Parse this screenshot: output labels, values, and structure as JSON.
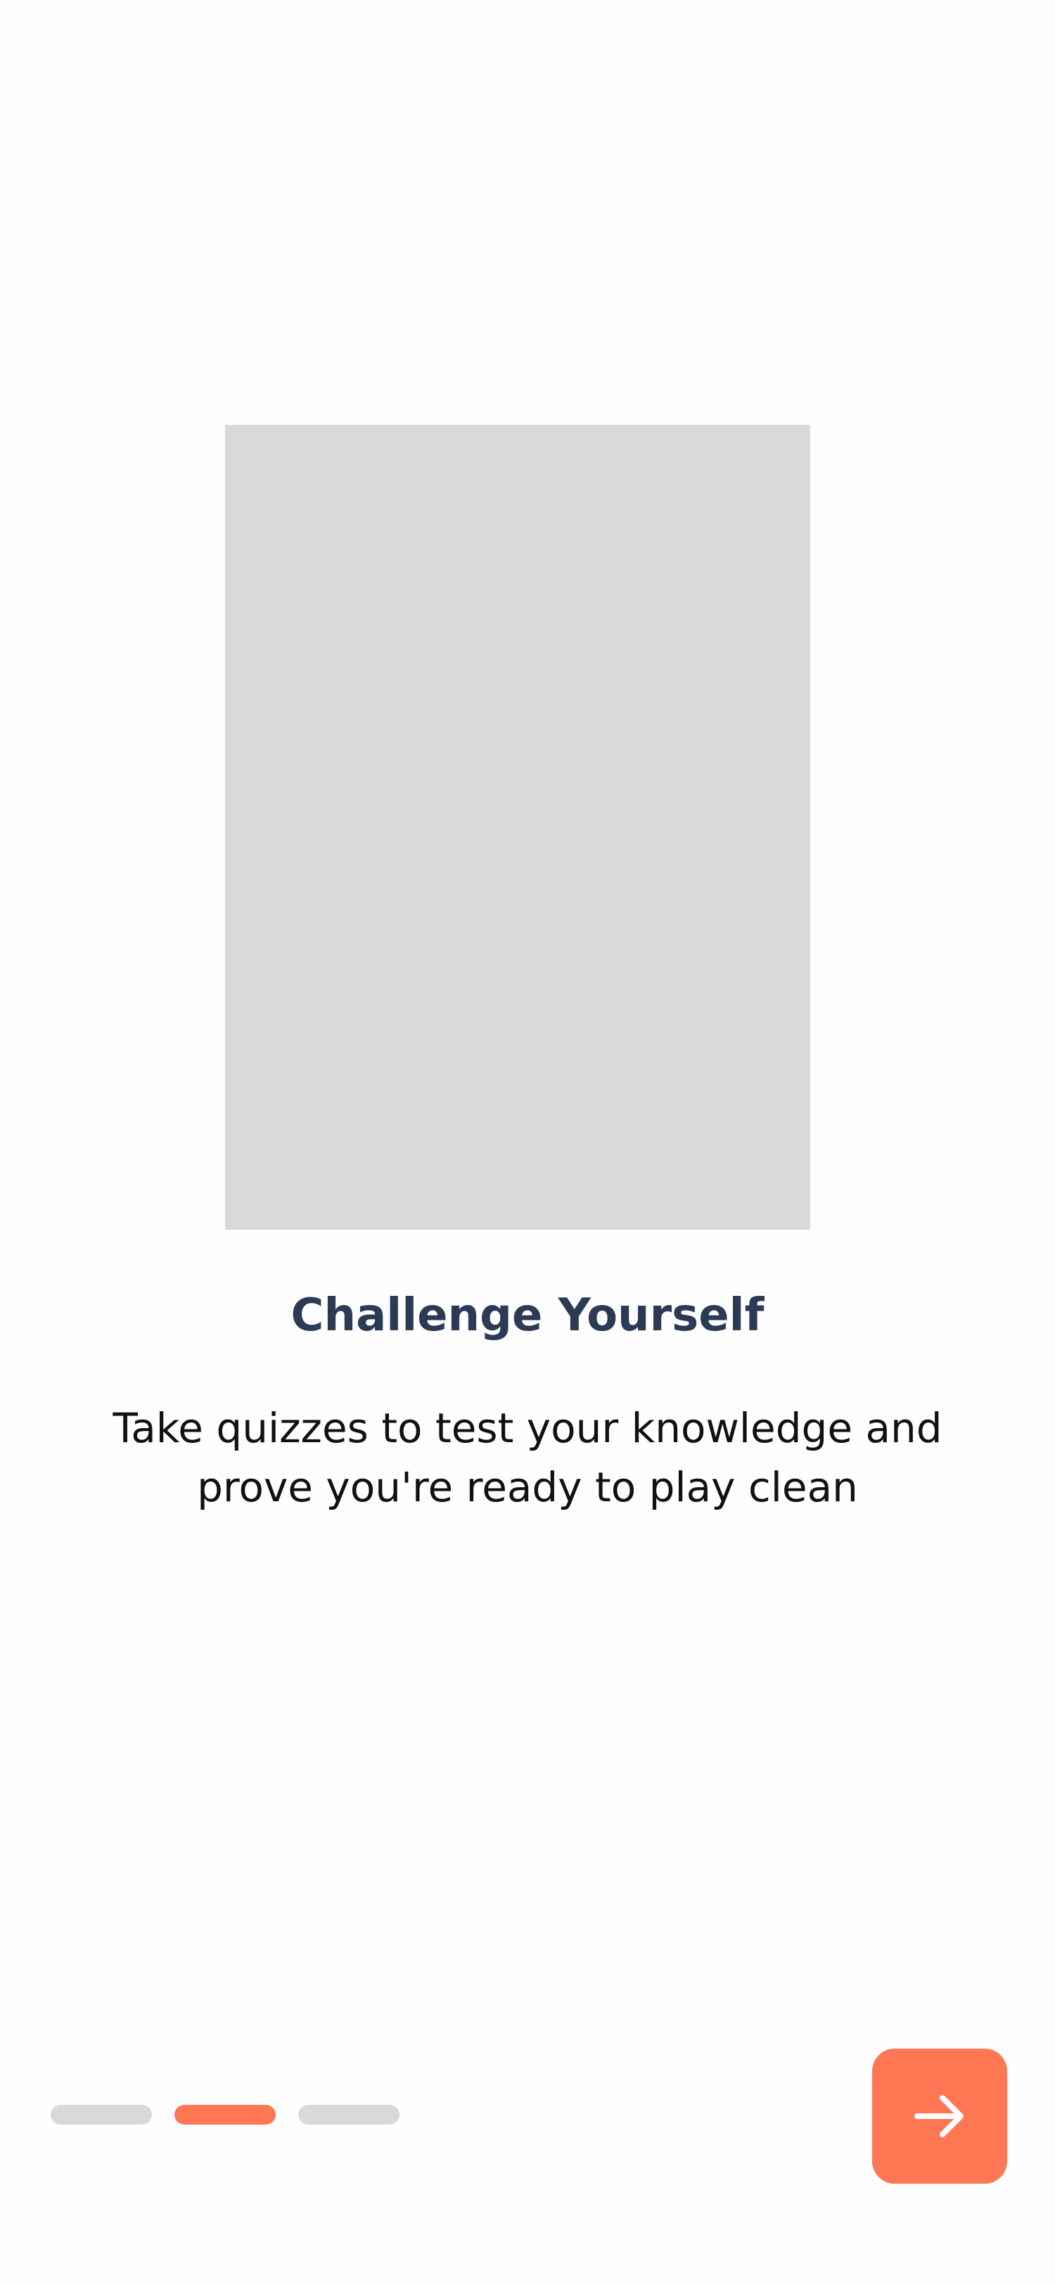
{
  "onboarding": {
    "title": "Challenge Yourself",
    "description": "Take quizzes to test your knowledge and prove you're ready to play clean",
    "current_step": 2,
    "total_steps": 3,
    "next_icon": "arrow-right-icon"
  },
  "colors": {
    "accent": "#ff7753",
    "title": "#2b3a55",
    "body_text": "#111111",
    "placeholder": "#d9d9d9",
    "background": "#fefefe"
  }
}
